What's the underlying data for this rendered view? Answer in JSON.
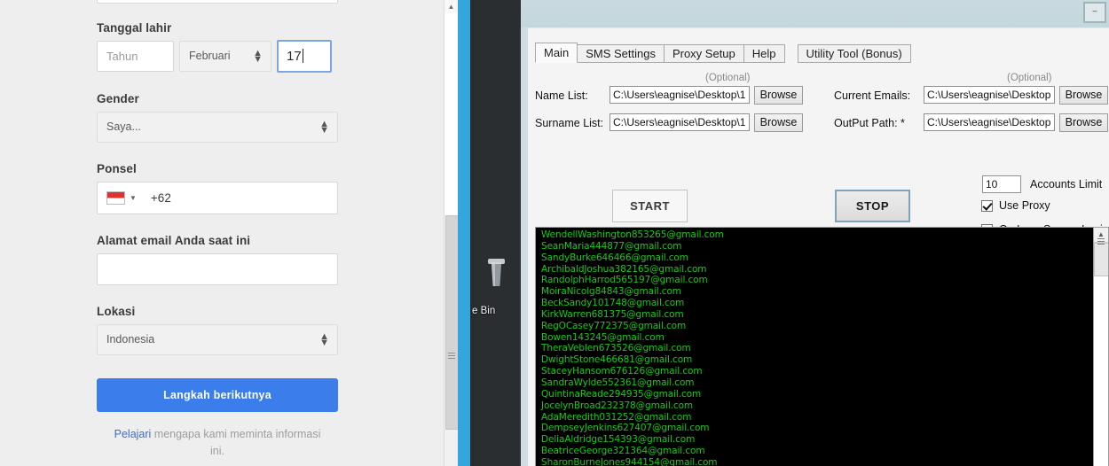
{
  "browser_form": {
    "dob": {
      "label": "Tanggal lahir",
      "year_placeholder": "Tahun",
      "month_value": "Februari",
      "day_value": "17"
    },
    "gender": {
      "label": "Gender",
      "value": "Saya..."
    },
    "phone": {
      "label": "Ponsel",
      "country_code": "+62",
      "flag_icon": "indonesia-flag-icon"
    },
    "email": {
      "label": "Alamat email Anda saat ini",
      "value": ""
    },
    "location": {
      "label": "Lokasi",
      "value": "Indonesia"
    },
    "next_button": "Langkah berikutnya",
    "help_link": "Pelajari",
    "help_text": " mengapa kami meminta informasi ini."
  },
  "desktop": {
    "recycle_bin_label": "e Bin",
    "window_edge_color": "#34a5dd",
    "background_color": "#2b2e31"
  },
  "app": {
    "titlebar": {
      "minimize_label": "–"
    },
    "tabs": [
      {
        "label": "Main",
        "active": true
      },
      {
        "label": "SMS Settings",
        "active": false
      },
      {
        "label": "Proxy Setup",
        "active": false
      },
      {
        "label": "Help",
        "active": false
      },
      {
        "label": "Utility Tool  (Bonus)",
        "active": false
      }
    ],
    "left_optional": "(Optional)",
    "right_optional": "(Optional)",
    "fields": [
      {
        "label": "Name List:",
        "value": "C:\\Users\\eagnise\\Desktop\\1",
        "browse": "Browse"
      },
      {
        "label": "Surname List:",
        "value": "C:\\Users\\eagnise\\Desktop\\1",
        "browse": "Browse"
      },
      {
        "label": "Current Emails:",
        "value": "C:\\Users\\eagnise\\Desktop",
        "browse": "Browse"
      },
      {
        "label": "OutPut Path: *",
        "value": "C:\\Users\\eagnise\\Desktop",
        "browse": "Browse"
      }
    ],
    "start_button": "START",
    "stop_button": "STOP",
    "accounts_limit": {
      "value": "10",
      "label": "Accounts Limit"
    },
    "use_proxy": {
      "label": "Use Proxy",
      "checked": true
    },
    "less_secure": {
      "label": "On Less Secure Login",
      "checked": false
    },
    "console": {
      "text_color": "#15cc15",
      "background_color": "#000000",
      "lines": [
        "WendellWashington853265@gmail.com",
        "SeanMaria444877@gmail.com",
        "SandyBurke646466@gmail.com",
        "ArchibaldJoshua382165@gmail.com",
        "RandolphHarrod565197@gmail.com",
        "MoiraNicolg84843@gmail.com",
        "BeckSandy101748@gmail.com",
        "KirkWarren681375@gmail.com",
        "RegOCasey772375@gmail.com",
        "Bowen143245@gmail.com",
        "TheraVeblen673526@gmail.com",
        "DwightStone466681@gmail.com",
        "StaceyHansom676126@gmail.com",
        "SandraWylde552361@gmail.com",
        "QuintinaReade294935@gmail.com",
        "JocelynBroad232378@gmail.com",
        "AdaMeredith031252@gmail.com",
        "DempseyJenkins627407@gmail.com",
        "DeliaAldridge154393@gmail.com",
        "BeatriceGeorge321364@gmail.com",
        "SharonBurneJones944154@gmail.com"
      ]
    }
  }
}
